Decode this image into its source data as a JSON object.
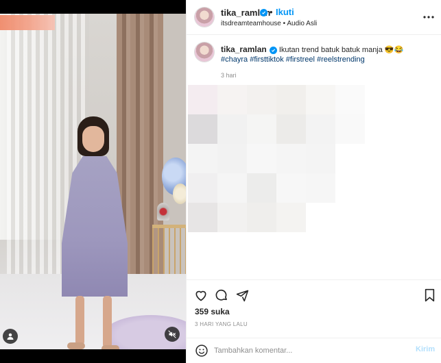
{
  "post": {
    "username": "tika_ramlan",
    "follow_label": "Ikuti",
    "separator": "•",
    "location": "itsdreamteamhouse",
    "audio": "Audio Asli"
  },
  "caption": {
    "username": "tika_ramlan",
    "text": "Ikutan trend batuk batuk manja 😎😂",
    "hashtags": [
      "#chayra",
      "#firsttiktok",
      "#firstreel",
      "#reelstrending"
    ],
    "time": "3 hari"
  },
  "stats": {
    "likes": "359 suka",
    "posted_ago": "3 HARI YANG LALU"
  },
  "comment": {
    "placeholder": "Tambahkan komentar...",
    "send_label": "Kirim"
  },
  "icons": {
    "verified": "verified-badge-icon",
    "more": "more-options-icon",
    "like": "heart-icon",
    "comment": "comment-bubble-icon",
    "share": "send-plane-icon",
    "save": "bookmark-icon",
    "emoji": "smiley-icon",
    "tag": "user-tag-icon",
    "mute": "speaker-muted-icon"
  },
  "colors": {
    "accent": "#0095f6",
    "link": "#00376b",
    "muted_text": "#8e8e8e",
    "send_disabled": "#b2dffc"
  }
}
